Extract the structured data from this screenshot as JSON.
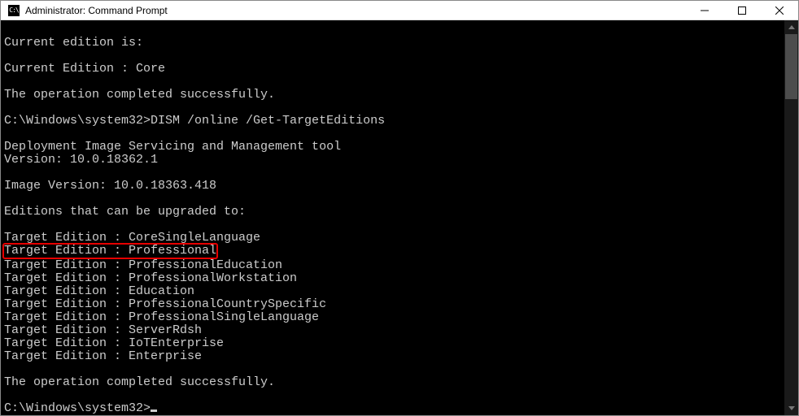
{
  "window": {
    "title": "Administrator: Command Prompt",
    "icon_label": "cmd-icon"
  },
  "terminal": {
    "lines": [
      "",
      "Current edition is:",
      "",
      "Current Edition : Core",
      "",
      "The operation completed successfully.",
      "",
      "C:\\Windows\\system32>DISM /online /Get-TargetEditions",
      "",
      "Deployment Image Servicing and Management tool",
      "Version: 10.0.18362.1",
      "",
      "Image Version: 10.0.18363.418",
      "",
      "Editions that can be upgraded to:",
      "",
      "Target Edition : CoreSingleLanguage",
      "Target Edition : Professional",
      "Target Edition : ProfessionalEducation",
      "Target Edition : ProfessionalWorkstation",
      "Target Edition : Education",
      "Target Edition : ProfessionalCountrySpecific",
      "Target Edition : ProfessionalSingleLanguage",
      "Target Edition : ServerRdsh",
      "Target Edition : IoTEnterprise",
      "Target Edition : Enterprise",
      "",
      "The operation completed successfully.",
      "",
      "C:\\Windows\\system32>"
    ],
    "highlighted_line_index": 17,
    "prompt_line_index": 29
  }
}
